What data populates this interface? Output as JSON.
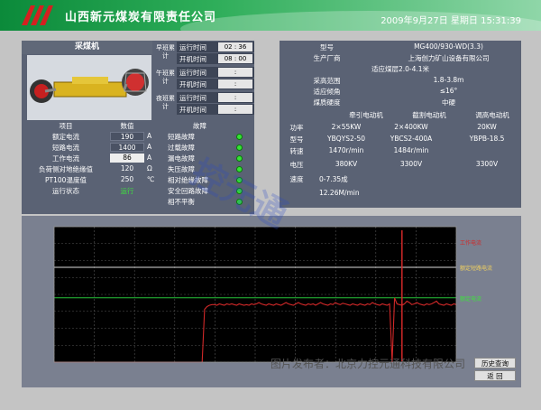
{
  "header": {
    "company": "山西新元煤炭有限责任公司",
    "datetime": "2009年9月27日  星期日  15:31:39"
  },
  "left_panel": {
    "title": "采煤机",
    "shifts": [
      {
        "label": "早班累计",
        "rows": [
          {
            "k": "运行时间",
            "v": "02 : 36"
          },
          {
            "k": "开机时间",
            "v": "08 : 00"
          }
        ]
      },
      {
        "label": "午班累计",
        "rows": [
          {
            "k": "运行时间",
            "v": ":"
          },
          {
            "k": "开机时间",
            "v": ":"
          }
        ]
      },
      {
        "label": "夜班累计",
        "rows": [
          {
            "k": "运行时间",
            "v": ":"
          },
          {
            "k": "开机时间",
            "v": ":"
          }
        ]
      }
    ],
    "table_headers": {
      "item": "项目",
      "value": "数值",
      "fault": "故障"
    },
    "params": [
      {
        "name": "额定电流",
        "value": "190",
        "unit": "A"
      },
      {
        "name": "短路电流",
        "value": "1400",
        "unit": "A"
      },
      {
        "name": "工作电流",
        "value": "86",
        "unit": "A"
      },
      {
        "name": "负荷侧对地绝缘值",
        "value": "120",
        "unit": "Ω"
      },
      {
        "name": "PT100温度值",
        "value": "250",
        "unit": "℃"
      },
      {
        "name": "运行状态",
        "value": "运行",
        "unit": ""
      }
    ],
    "faults": [
      "短路故障",
      "过载故障",
      "漏电故障",
      "失压故障",
      "相对绝缘故障",
      "安全回路故障",
      "相不平衡"
    ]
  },
  "right_panel": {
    "info": [
      {
        "k": "型号",
        "v": "MG400/930-WD(3.3)"
      },
      {
        "k": "生产厂商",
        "v": "上海创力矿山设备有限公司"
      },
      {
        "k": "",
        "v": "适应煤层2.0-4.1米"
      },
      {
        "k": "采高范围",
        "v": "1.8-3.8m"
      },
      {
        "k": "适应倾角",
        "v": "≤16°"
      },
      {
        "k": "煤质硬度",
        "v": "中硬"
      }
    ],
    "motor_headers": [
      "",
      "牵引电动机",
      "截割电动机",
      "调高电动机"
    ],
    "motor_rows": [
      [
        "功率",
        "2×55KW",
        "2×400KW",
        "20KW"
      ],
      [
        "型号",
        "YBQYS2-50",
        "YBCS2-400A",
        "YBPB-18.5"
      ],
      [
        "转速",
        "1470r/min",
        "1484r/min",
        ""
      ],
      [
        "电压",
        "380KV",
        "3300V",
        "3300V"
      ]
    ],
    "speed_label": "速度",
    "speed_values": [
      "0-7.35成",
      "12.26M/min"
    ]
  },
  "chart": {
    "legend_top": "工作电流",
    "ref_line_1": "额定短路电流",
    "ref_line_2": "额定电流",
    "buttons": {
      "history": "历史查询",
      "back": "返  回"
    }
  },
  "chart_data": {
    "type": "line",
    "title": "",
    "series": [
      {
        "name": "工作电流",
        "values": [
          0,
          0,
          0,
          0,
          0,
          0,
          0,
          0,
          0,
          0,
          0,
          0,
          0,
          0,
          0,
          0,
          0,
          0,
          0,
          0,
          0,
          0,
          0,
          0,
          0,
          0,
          0,
          0,
          0,
          0,
          0,
          0,
          0,
          0,
          0,
          0,
          0,
          0,
          0,
          0,
          0,
          0,
          0,
          0,
          0,
          0,
          0,
          0,
          0,
          0,
          0,
          0,
          0,
          0,
          0,
          0,
          0,
          0,
          0,
          0,
          0,
          78,
          82,
          84,
          85,
          85,
          84,
          86,
          85,
          84,
          86,
          85,
          86,
          85,
          84,
          86,
          85,
          84,
          85,
          84,
          86,
          85,
          86,
          88,
          86,
          85,
          84,
          86,
          85,
          84,
          86,
          85,
          84,
          86,
          88,
          86,
          85,
          84,
          86,
          88,
          86,
          85,
          84,
          86,
          85,
          86,
          84,
          86,
          88,
          86,
          85,
          84,
          86,
          85,
          88,
          86,
          85,
          87,
          86,
          85,
          84,
          86,
          85,
          84,
          86,
          85,
          84,
          86,
          85,
          88,
          86,
          85,
          84,
          86,
          85,
          84,
          86,
          0,
          95,
          86,
          85,
          84,
          86,
          90,
          88,
          85,
          86,
          88,
          86,
          85,
          84,
          86,
          85,
          86,
          88,
          90,
          86,
          85,
          84,
          86,
          85,
          84,
          86,
          85
        ]
      }
    ],
    "hlines": [
      {
        "label": "额定短路电流",
        "value": 140
      },
      {
        "label": "额定电流",
        "value": 95
      }
    ],
    "ylim": [
      0,
      200
    ]
  },
  "footer": {
    "credit": "图片发布者：北京力控元通科技有限公司"
  },
  "watermark_text": "控元通"
}
